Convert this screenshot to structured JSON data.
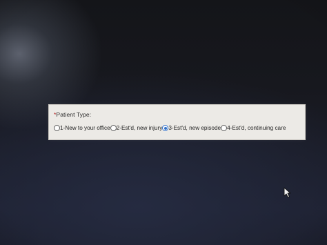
{
  "form": {
    "required_marker": "*",
    "patient_type_label": "Patient Type:",
    "options": [
      {
        "label": "1-New to your office",
        "checked": false
      },
      {
        "label": "2-Est'd, new injury",
        "checked": false
      },
      {
        "label": "3-Est'd, new episode",
        "checked": true
      },
      {
        "label": "4-Est'd, continuing care",
        "checked": false
      }
    ]
  },
  "colors": {
    "panel_background": "#eceae6",
    "selected_radio": "#2f6fc9",
    "screen_background": "#17181e"
  },
  "icons": {
    "cursor": "mouse-pointer-icon"
  }
}
